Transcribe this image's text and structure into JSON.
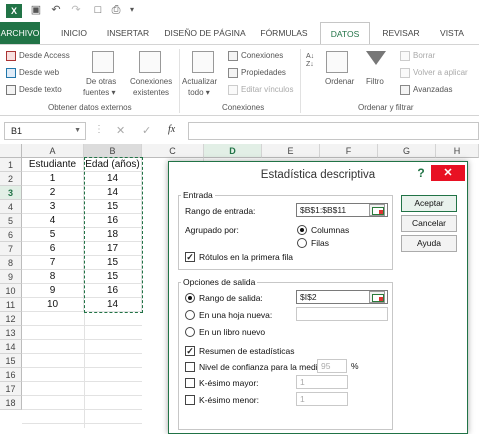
{
  "qat": {
    "undo_icon": "undo-icon",
    "redo_icon": "redo-icon",
    "save_icon": "save-icon"
  },
  "tabs": {
    "archivo": "ARCHIVO",
    "inicio": "INICIO",
    "insertar": "INSERTAR",
    "diseno": "DISEÑO DE PÁGINA",
    "formulas": "FÓRMULAS",
    "datos": "DATOS",
    "revisar": "REVISAR",
    "vista": "VISTA"
  },
  "ribbon": {
    "desde_access": "Desde Access",
    "desde_web": "Desde web",
    "desde_texto": "Desde texto",
    "de_otras_1": "De otras",
    "de_otras_2": "fuentes ▾",
    "conexiones_ex_1": "Conexiones",
    "conexiones_ex_2": "existentes",
    "group_externos": "Obtener datos externos",
    "actualizar_1": "Actualizar",
    "actualizar_2": "todo ▾",
    "conexiones": "Conexiones",
    "propiedades": "Propiedades",
    "editar_vinculos": "Editar vínculos",
    "group_conexiones": "Conexiones",
    "ordenar": "Ordenar",
    "filtro": "Filtro",
    "borrar": "Borrar",
    "volver_aplicar": "Volver a aplicar",
    "avanzadas": "Avanzadas",
    "group_ordenar": "Ordenar y filtrar"
  },
  "formula_bar": {
    "name_box": "B1",
    "fx": "fx",
    "cancel": "✕",
    "enter": "✓",
    "value": ""
  },
  "columns": [
    "A",
    "B",
    "C",
    "D",
    "E",
    "F",
    "G",
    "H"
  ],
  "rows": [
    "1",
    "2",
    "3",
    "4",
    "5",
    "6",
    "7",
    "8",
    "9",
    "10",
    "11",
    "12",
    "13",
    "14",
    "15",
    "16",
    "17",
    "18"
  ],
  "table": {
    "headers": [
      "Estudiante",
      "Edad (años)"
    ],
    "rows": [
      [
        "1",
        "14"
      ],
      [
        "2",
        "14"
      ],
      [
        "3",
        "15"
      ],
      [
        "4",
        "16"
      ],
      [
        "5",
        "18"
      ],
      [
        "6",
        "17"
      ],
      [
        "7",
        "15"
      ],
      [
        "8",
        "15"
      ],
      [
        "9",
        "16"
      ],
      [
        "10",
        "14"
      ]
    ]
  },
  "dialog": {
    "title": "Estadística descriptiva",
    "help": "?",
    "close": "✕",
    "entrada_label": "Entrada",
    "rango_entrada_label": "Rango de entrada:",
    "rango_entrada_value": "$B$1:$B$11",
    "agrupado_label": "Agrupado por:",
    "columnas": "Columnas",
    "filas": "Filas",
    "rotulos": "Rótulos en la primera fila",
    "salida_label": "Opciones de salida",
    "rango_salida": "Rango de salida:",
    "rango_salida_value": "$I$2",
    "hoja_nueva": "En una hoja nueva:",
    "libro_nuevo": "En un libro nuevo",
    "resumen": "Resumen de estadísticas",
    "nivel_confianza": "Nivel de confianza para la media:",
    "nivel_value": "95",
    "pct": "%",
    "k_mayor": "K-ésimo mayor:",
    "k_mayor_value": "1",
    "k_menor": "K-ésimo menor:",
    "k_menor_value": "1",
    "aceptar": "Aceptar",
    "cancelar": "Cancelar",
    "ayuda": "Ayuda"
  }
}
